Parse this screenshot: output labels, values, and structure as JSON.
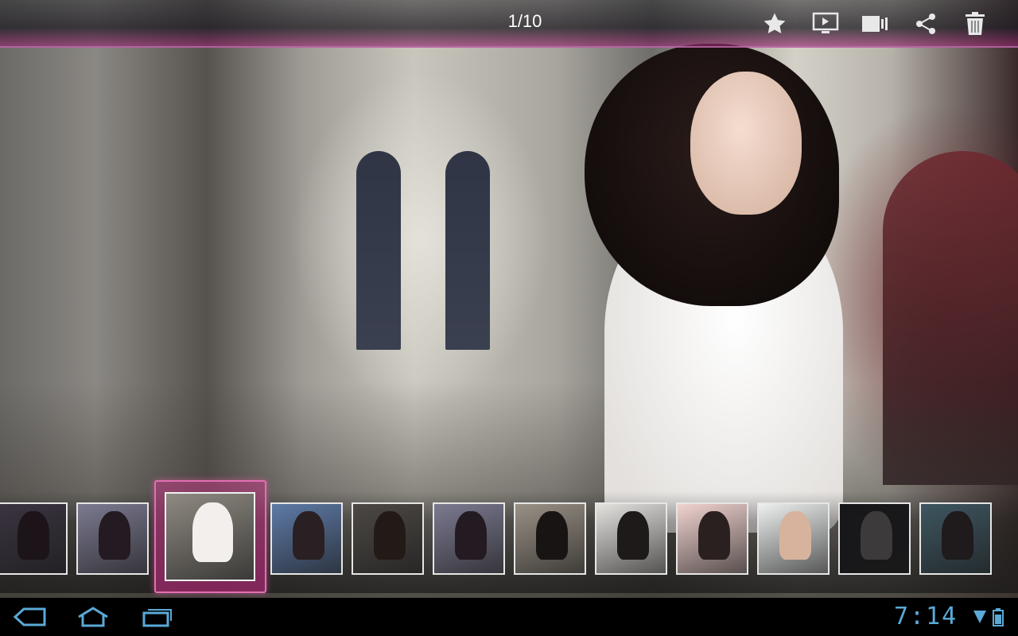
{
  "viewer": {
    "counter": "1/10"
  },
  "actions": [
    {
      "name": "favorite-button",
      "icon": "star-icon"
    },
    {
      "name": "slideshow-button",
      "icon": "play-slideshow-icon"
    },
    {
      "name": "video-button",
      "icon": "video-camera-icon"
    },
    {
      "name": "share-button",
      "icon": "share-icon"
    },
    {
      "name": "delete-button",
      "icon": "trash-icon"
    }
  ],
  "filmstrip": {
    "selected_index": 2,
    "thumbnails": [
      {
        "bg": "#3a3440",
        "fig": "#1c1418"
      },
      {
        "bg": "#7c7a90",
        "fig": "#241a22"
      },
      {
        "bg": "#8f8a82",
        "fig": "#f2efec"
      },
      {
        "bg": "#5e7aa6",
        "fig": "#2a1f22"
      },
      {
        "bg": "#4c4844",
        "fig": "#231a18"
      },
      {
        "bg": "#7c7a90",
        "fig": "#241a22"
      },
      {
        "bg": "#9a9186",
        "fig": "#191414"
      },
      {
        "bg": "#e4e2df",
        "fig": "#1f1a1a"
      },
      {
        "bg": "#f1d3d0",
        "fig": "#2b2020"
      },
      {
        "bg": "#eef0f0",
        "fig": "#d7b39e"
      },
      {
        "bg": "#17171a",
        "fig": "#3c3a3a"
      },
      {
        "bg": "#3e5660",
        "fig": "#1f1a1c"
      }
    ]
  },
  "status": {
    "time": "7:14"
  },
  "colors": {
    "accent": "#e36fb2",
    "clock": "#5aa9d6",
    "nav_icon": "#5aa9d6"
  },
  "system_nav": [
    {
      "name": "back-button",
      "icon": "back-icon"
    },
    {
      "name": "home-button",
      "icon": "home-icon"
    },
    {
      "name": "recent-apps-button",
      "icon": "recent-apps-icon"
    }
  ]
}
